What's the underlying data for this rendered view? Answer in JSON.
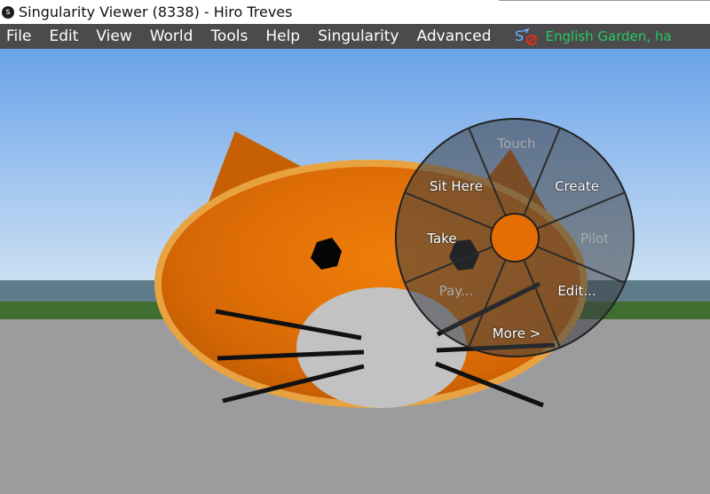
{
  "window": {
    "title": "Singularity Viewer (8338) - Hiro Treves"
  },
  "menubar": {
    "items": [
      "File",
      "Edit",
      "View",
      "World",
      "Tools",
      "Help",
      "Singularity",
      "Advanced"
    ],
    "status_icon": "script-disabled-icon",
    "region": "English Garden, ha"
  },
  "pie_menu": {
    "touch": "Touch",
    "create": "Create",
    "sit_here": "Sit Here",
    "take": "Take",
    "rightmid": "Pilot",
    "pay": "Pay...",
    "edit": "Edit...",
    "more": "More >"
  },
  "colors": {
    "menubar": "#4b4b4e",
    "region_text": "#27c85f",
    "sky_top": "#69a2e9",
    "cat_orange": "#d86a05",
    "ground": "#9c9c9f",
    "pie_center": "#e56e04"
  }
}
